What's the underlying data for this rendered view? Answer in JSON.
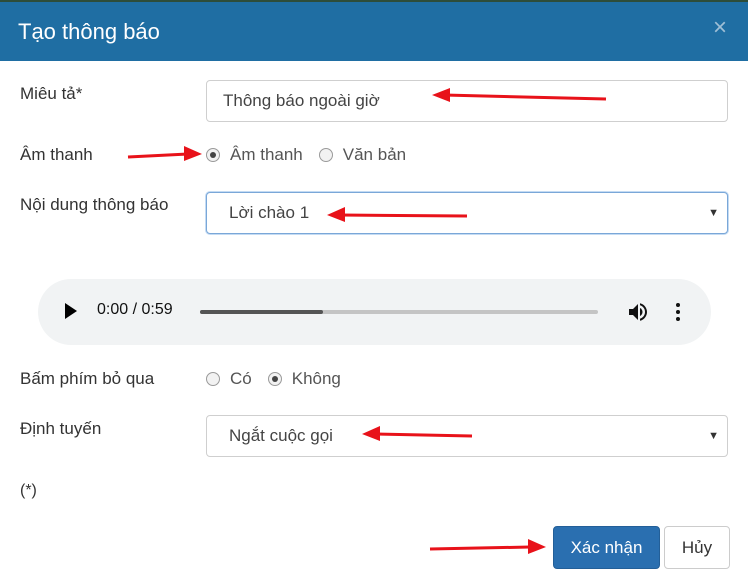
{
  "modal": {
    "title": "Tạo thông báo",
    "close_symbol": "×"
  },
  "form": {
    "description": {
      "label": "Miêu tả*",
      "value": "Thông báo ngoài giờ"
    },
    "sound_type": {
      "label": "Âm thanh",
      "options": [
        {
          "label": "Âm thanh",
          "checked": true
        },
        {
          "label": "Văn bản",
          "checked": false
        }
      ]
    },
    "content": {
      "label": "Nội dung thông báo",
      "selected": "Lời chào 1"
    },
    "audio": {
      "time": "0:00 / 0:59",
      "progress_fraction": 0.31,
      "icons": [
        "play-icon",
        "volume-icon",
        "more-vertical-icon"
      ]
    },
    "skip_key": {
      "label": "Bấm phím bỏ qua",
      "options": [
        {
          "label": "Có",
          "checked": false
        },
        {
          "label": "Không",
          "checked": true
        }
      ]
    },
    "routing": {
      "label": "Định tuyến",
      "selected": "Ngắt cuộc gọi"
    },
    "required_note": "(*)"
  },
  "footer": {
    "confirm_label": "Xác nhận",
    "cancel_label": "Hủy"
  },
  "colors": {
    "header_bg": "#1f6ea3",
    "primary_button": "#2a6fb0",
    "annotation_arrow": "#e8121a"
  }
}
